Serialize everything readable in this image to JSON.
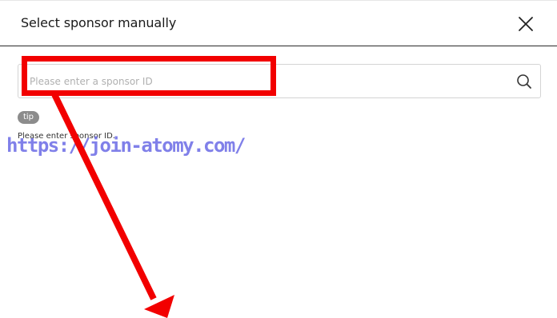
{
  "modal": {
    "title": "Select sponsor manually"
  },
  "search": {
    "placeholder": "Please enter a sponsor ID",
    "value": ""
  },
  "tip": {
    "badge": "tip",
    "text": "Please enter sponsor ID."
  },
  "watermark": {
    "text": "https://join-atomy.com/"
  },
  "icons": {
    "close": "close-icon",
    "search": "search-icon"
  },
  "colors": {
    "annotation": "#f20000",
    "watermark": "#6e6ee6",
    "badge": "#8c8c8c",
    "header_border": "#2a2a2a"
  }
}
